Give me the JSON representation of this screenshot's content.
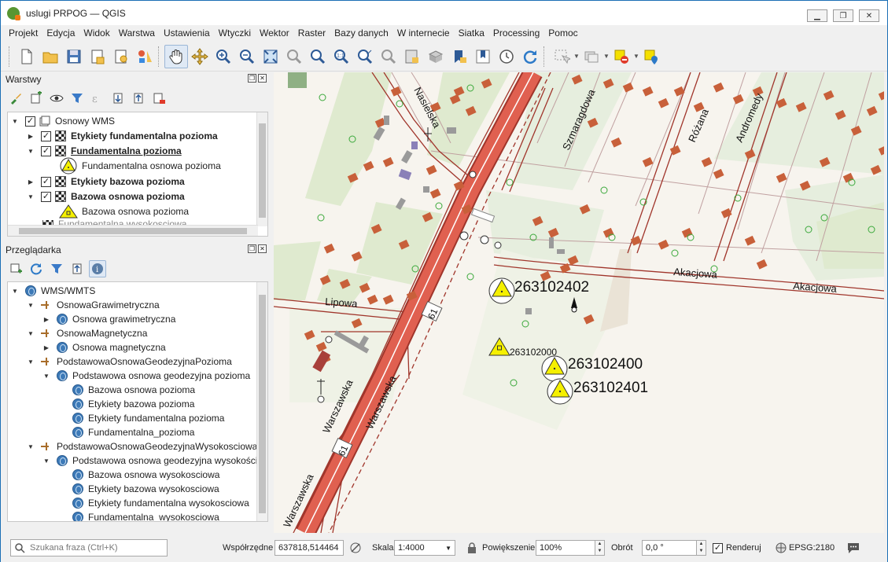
{
  "window": {
    "title": "uslugi PRPOG — QGIS",
    "minimize": "▁",
    "maximize": "❐",
    "close": "✕"
  },
  "menu": [
    "Projekt",
    "Edycja",
    "Widok",
    "Warstwa",
    "Ustawienia",
    "Wtyczki",
    "Wektor",
    "Raster",
    "Bazy danych",
    "W internecie",
    "Siatka",
    "Processing",
    "Pomoc"
  ],
  "layers_panel": {
    "title": "Warstwy",
    "items": [
      {
        "label": "Osnowy WMS",
        "bold": false,
        "underline": false,
        "checked": true,
        "icon": "group-icon"
      },
      {
        "label": "Etykiety fundamentalna pozioma",
        "bold": true,
        "underline": false,
        "checked": true,
        "icon": "raster-layer-icon"
      },
      {
        "label": "Fundamentalna pozioma",
        "bold": true,
        "underline": true,
        "checked": true,
        "icon": "raster-layer-icon"
      },
      {
        "label": "Fundamentalna osnowa pozioma",
        "bold": false,
        "underline": false,
        "checked": null,
        "icon": "legend-triangle-icon"
      },
      {
        "label": "Etykiety bazowa pozioma",
        "bold": true,
        "underline": false,
        "checked": true,
        "icon": "raster-layer-icon"
      },
      {
        "label": "Bazowa osnowa pozioma",
        "bold": true,
        "underline": false,
        "checked": true,
        "icon": "raster-layer-icon"
      },
      {
        "label": "Bazowa osnowa pozioma",
        "bold": false,
        "underline": false,
        "checked": null,
        "icon": "legend-triangle-icon"
      },
      {
        "label": "Fundamentalna wysokosciowa",
        "bold": false,
        "underline": false,
        "checked": null,
        "icon": "raster-layer-icon"
      }
    ]
  },
  "browser_panel": {
    "title": "Przeglądarka",
    "items": [
      {
        "label": "WMS/WMTS",
        "level": 0,
        "icon": "globe-icon",
        "expand": "▼"
      },
      {
        "label": "OsnowaGrawimetryczna",
        "level": 1,
        "icon": "wms-icon",
        "expand": "▼"
      },
      {
        "label": "Osnowa grawimetryczna",
        "level": 2,
        "icon": "globe-icon",
        "expand": "▶"
      },
      {
        "label": "OsnowaMagnetyczna",
        "level": 1,
        "icon": "wms-icon",
        "expand": "▼"
      },
      {
        "label": "Osnowa magnetyczna",
        "level": 2,
        "icon": "globe-icon",
        "expand": "▶"
      },
      {
        "label": "PodstawowaOsnowaGeodezyjnaPozioma",
        "level": 1,
        "icon": "wms-icon",
        "expand": "▼"
      },
      {
        "label": "Podstawowa osnowa geodezyjna pozioma",
        "level": 2,
        "icon": "globe-icon",
        "expand": "▼"
      },
      {
        "label": "Bazowa osnowa pozioma",
        "level": 3,
        "icon": "globe-icon",
        "expand": ""
      },
      {
        "label": "Etykiety bazowa pozioma",
        "level": 3,
        "icon": "globe-icon",
        "expand": ""
      },
      {
        "label": "Etykiety fundamentalna pozioma",
        "level": 3,
        "icon": "globe-icon",
        "expand": ""
      },
      {
        "label": "Fundamentalna_pozioma",
        "level": 3,
        "icon": "globe-icon",
        "expand": ""
      },
      {
        "label": "PodstawowaOsnowaGeodezyjnaWysokosciowa",
        "level": 1,
        "icon": "wms-icon",
        "expand": "▼"
      },
      {
        "label": "Podstawowa osnowa geodezyjna wysokości",
        "level": 2,
        "icon": "globe-icon",
        "expand": "▼"
      },
      {
        "label": "Bazowa osnowa wysokosciowa",
        "level": 3,
        "icon": "globe-icon",
        "expand": ""
      },
      {
        "label": "Etykiety bazowa wysokosciowa",
        "level": 3,
        "icon": "globe-icon",
        "expand": ""
      },
      {
        "label": "Etykiety fundamentalna wysokosciowa",
        "level": 3,
        "icon": "globe-icon",
        "expand": ""
      },
      {
        "label": "Fundamentalna_wysokosciowa",
        "level": 3,
        "icon": "globe-icon",
        "expand": ""
      }
    ]
  },
  "map": {
    "streets": [
      "Nasielska",
      "Szmaragdowa",
      "Różana",
      "Andromedy",
      "Akacjowa",
      "Akacjowa",
      "Lipowa",
      "Warszawska",
      "Warszawska",
      "Warszawska",
      "61",
      "61"
    ],
    "points": [
      "263102402",
      "263102000",
      "263102400",
      "263102401"
    ],
    "colors": {
      "road_main": "#e06050",
      "road_outline": "#a0352b",
      "building": "#c8603a",
      "vegetation": "#dfeacf",
      "ground": "#f7f4ee",
      "marker": "#f5f000"
    }
  },
  "statusbar": {
    "search_placeholder": "Szukana fraza (Ctrl+K)",
    "coord_label": "Współrzędne",
    "coord_value": "637818,514464",
    "scale_label": "Skala",
    "scale_value": "1:4000",
    "zoom_label": "Powiększenie",
    "zoom_value": "100%",
    "rotation_label": "Obrót",
    "rotation_value": "0,0 °",
    "render_label": "Renderuj",
    "render_checked": true,
    "crs": "EPSG:2180"
  }
}
